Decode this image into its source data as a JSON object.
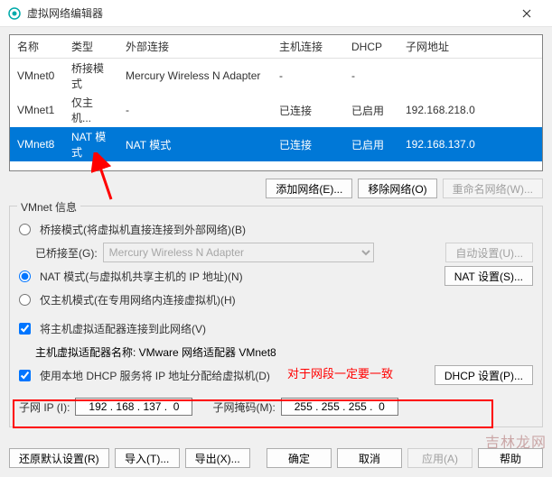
{
  "window": {
    "title": "虚拟网络编辑器",
    "icon": "vmware-icon"
  },
  "table": {
    "headers": [
      "名称",
      "类型",
      "外部连接",
      "主机连接",
      "DHCP",
      "子网地址"
    ],
    "rows": [
      {
        "name": "VMnet0",
        "type": "桥接模式",
        "ext": "Mercury Wireless N Adapter",
        "host": "-",
        "dhcp": "-",
        "subnet": ""
      },
      {
        "name": "VMnet1",
        "type": "仅主机...",
        "ext": "-",
        "host": "已连接",
        "dhcp": "已启用",
        "subnet": "192.168.218.0"
      },
      {
        "name": "VMnet8",
        "type": "NAT 模式",
        "ext": "NAT 模式",
        "host": "已连接",
        "dhcp": "已启用",
        "subnet": "192.168.137.0",
        "selected": true
      }
    ]
  },
  "buttons": {
    "add_network": "添加网络(E)...",
    "remove_network": "移除网络(O)",
    "rename_network": "重命名网络(W)...",
    "auto_settings": "自动设置(U)...",
    "nat_settings": "NAT 设置(S)...",
    "dhcp_settings": "DHCP 设置(P)...",
    "restore_defaults": "还原默认设置(R)",
    "import": "导入(T)...",
    "export": "导出(X)...",
    "ok": "确定",
    "cancel": "取消",
    "apply": "应用(A)",
    "help": "帮助"
  },
  "vmnet_info": {
    "legend": "VMnet 信息",
    "bridged_label": "桥接模式(将虚拟机直接连接到外部网络)(B)",
    "bridged_to_label": "已桥接至(G):",
    "bridged_adapter": "Mercury Wireless N Adapter",
    "nat_label": "NAT 模式(与虚拟机共享主机的 IP 地址)(N)",
    "hostonly_label": "仅主机模式(在专用网络内连接虚拟机)(H)",
    "connect_host_label": "将主机虚拟适配器连接到此网络(V)",
    "adapter_name_label": "主机虚拟适配器名称: VMware 网络适配器 VMnet8",
    "use_dhcp_label": "使用本地 DHCP 服务将 IP 地址分配给虚拟机(D)"
  },
  "subnet": {
    "ip_label": "子网 IP (I):",
    "ip_value": "192 . 168 . 137 .  0",
    "mask_label": "子网掩码(M):",
    "mask_value": "255 . 255 . 255 .  0"
  },
  "annotation": {
    "text": "对于网段一定要一致"
  },
  "watermark": "吉林龙网"
}
